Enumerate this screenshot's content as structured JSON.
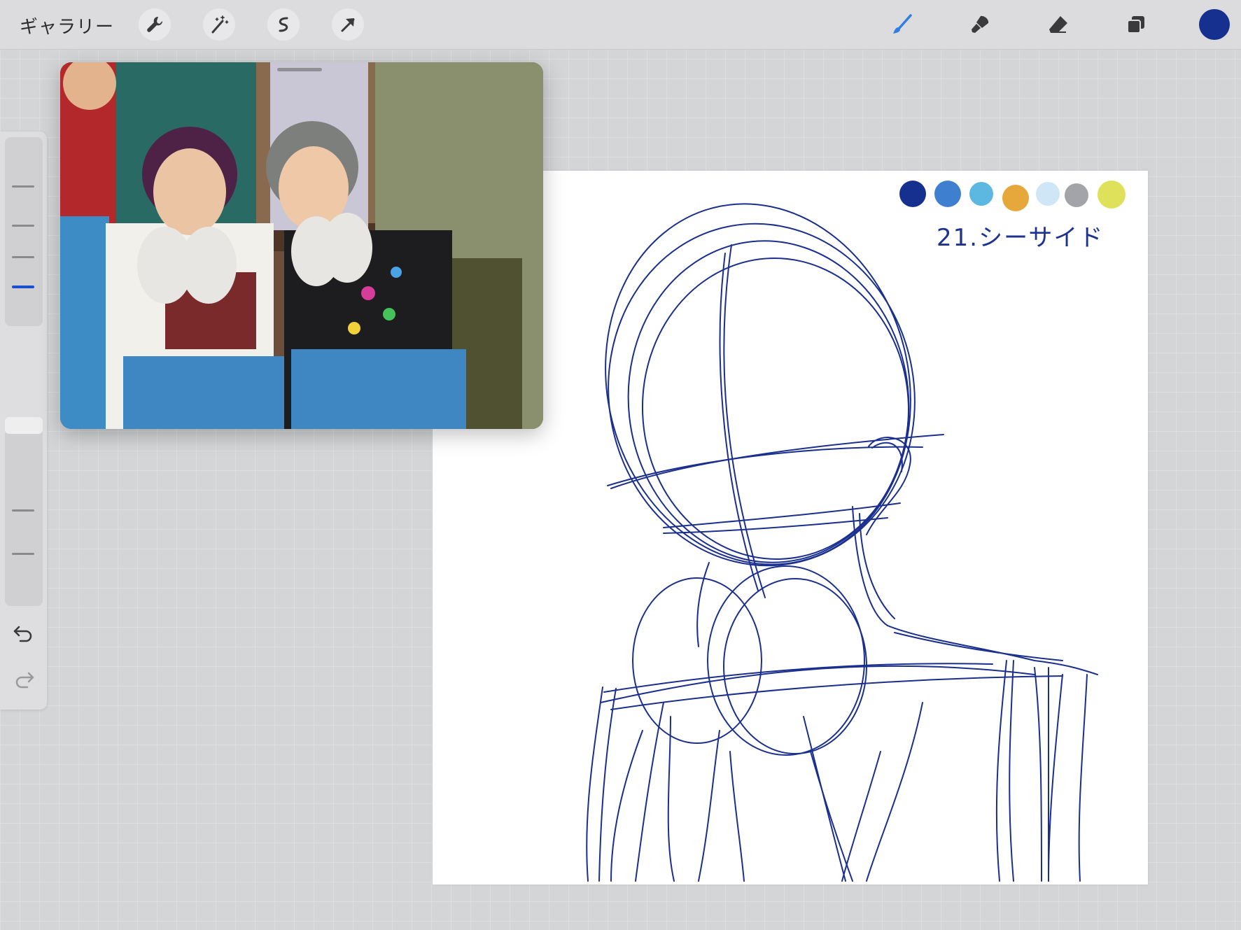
{
  "toolbar": {
    "gallery_label": "ギャラリー",
    "left_tools": [
      "wrench-icon",
      "magic-wand-icon",
      "selection-icon",
      "transform-arrow-icon"
    ],
    "right_tools": [
      "brush-icon",
      "smudge-icon",
      "eraser-icon",
      "layers-icon"
    ],
    "current_color": "#16308f",
    "brush_color": "#2f7ee6"
  },
  "sidebar": {
    "tools": [
      "brush-size-slider",
      "modify-button",
      "opacity-slider",
      "undo-icon",
      "redo-icon"
    ]
  },
  "canvas": {
    "title": "21.シーサイド",
    "palette": [
      "#16308f",
      "#3f7fcf",
      "#5cb8e0",
      "#e6a83a",
      "#cfe6f6",
      "#a3a4aa",
      "#dfe15a"
    ],
    "stroke_color": "#1a2f8e"
  },
  "reference": {
    "description_icon": "reference-photo"
  }
}
